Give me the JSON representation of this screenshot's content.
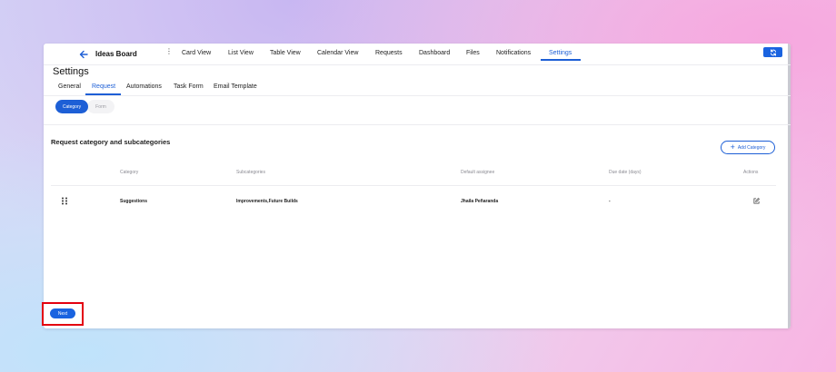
{
  "header": {
    "board_title": "Ideas Board",
    "nav": [
      "Card View",
      "List View",
      "Table View",
      "Calendar View",
      "Requests",
      "Dashboard",
      "Files",
      "Notifications",
      "Settings"
    ],
    "active_nav": "Settings"
  },
  "page": {
    "title": "Settings",
    "tabs": [
      "General",
      "Request",
      "Automations",
      "Task Form",
      "Email Template"
    ],
    "active_tab": "Request",
    "subtabs": [
      "Category",
      "Form"
    ],
    "active_subtab": "Category"
  },
  "section": {
    "title": "Request category and subcategories",
    "add_label": "Add Category"
  },
  "table": {
    "columns": [
      "Category",
      "Subcategories",
      "Default assignee",
      "Due date (days)",
      "Actions"
    ],
    "rows": [
      {
        "category": "Suggestions",
        "subcategories": "Improvements,Future Builds",
        "assignee": "Jhaila Peñaranda",
        "due": "-"
      }
    ]
  },
  "footer": {
    "next_label": "Next"
  },
  "colors": {
    "accent": "#1d5fd6",
    "highlight": "#e3000f"
  }
}
